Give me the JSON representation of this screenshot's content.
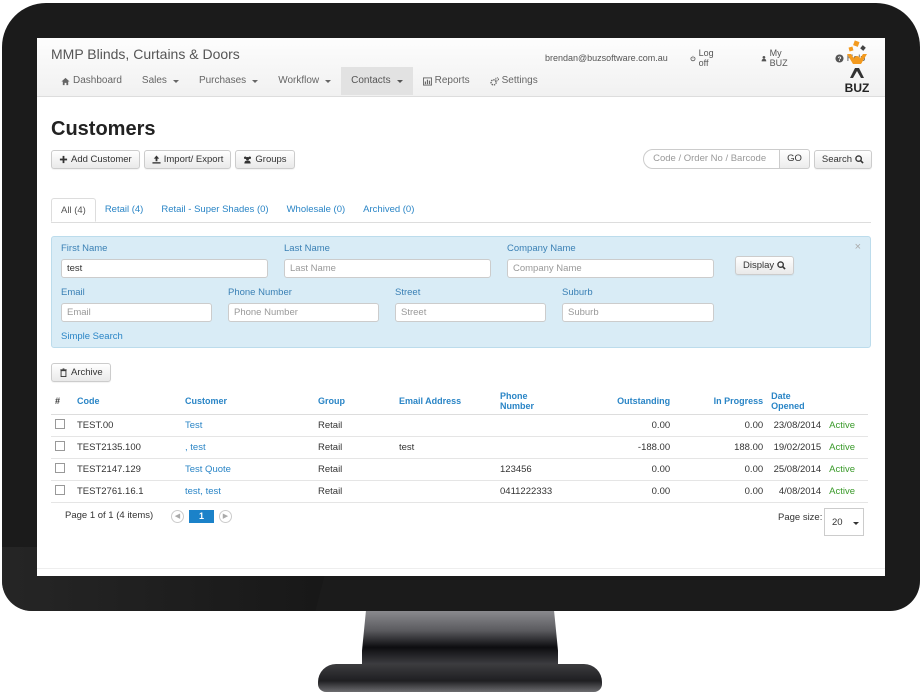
{
  "app": {
    "title": "MMP Blinds, Curtains & Doors",
    "user_email": "brendan@buzsoftware.com.au",
    "logoff_label": "Log off",
    "mybuz_label": "My BUZ",
    "help_label": "Help",
    "logo_text": "BUZ",
    "logo_colors": {
      "orange": "#f39a1e",
      "dark": "#333333"
    }
  },
  "nav": {
    "items": [
      {
        "label": "Dashboard",
        "icon": "home-icon",
        "dropdown": false,
        "active": false
      },
      {
        "label": "Sales",
        "dropdown": true,
        "active": false
      },
      {
        "label": "Purchases",
        "dropdown": true,
        "active": false
      },
      {
        "label": "Workflow",
        "dropdown": true,
        "active": false
      },
      {
        "label": "Contacts",
        "dropdown": true,
        "active": true
      },
      {
        "label": "Reports",
        "icon": "chart-icon",
        "dropdown": false,
        "active": false
      },
      {
        "label": "Settings",
        "icon": "gears-icon",
        "dropdown": false,
        "active": false
      }
    ]
  },
  "page": {
    "title": "Customers",
    "toolbar": {
      "add_label": "Add Customer",
      "import_label": "Import/ Export",
      "groups_label": "Groups"
    },
    "quick_search": {
      "placeholder": "Code / Order No / Barcode",
      "go_label": "GO",
      "search_label": "Search"
    }
  },
  "tabs": [
    {
      "label": "All (4)",
      "active": true
    },
    {
      "label": "Retail (4)",
      "active": false
    },
    {
      "label": "Retail - Super Shades (0)",
      "active": false
    },
    {
      "label": "Wholesale (0)",
      "active": false
    },
    {
      "label": "Archived (0)",
      "active": false
    }
  ],
  "filter": {
    "first_name": {
      "label": "First Name",
      "value": "test",
      "placeholder": "First Name"
    },
    "last_name": {
      "label": "Last Name",
      "value": "",
      "placeholder": "Last Name"
    },
    "company_name": {
      "label": "Company Name",
      "value": "",
      "placeholder": "Company Name"
    },
    "email": {
      "label": "Email",
      "value": "",
      "placeholder": "Email"
    },
    "phone": {
      "label": "Phone Number",
      "value": "",
      "placeholder": "Phone Number"
    },
    "street": {
      "label": "Street",
      "value": "",
      "placeholder": "Street"
    },
    "suburb": {
      "label": "Suburb",
      "value": "",
      "placeholder": "Suburb"
    },
    "display_label": "Display",
    "simple_search_label": "Simple Search",
    "close_glyph": "×"
  },
  "archive_label": "Archive",
  "table": {
    "columns": [
      "#",
      "Code",
      "Customer",
      "Group",
      "Email Address",
      "Phone Number",
      "Outstanding",
      "In Progress",
      "Date Opened",
      ""
    ],
    "rows": [
      {
        "code": "TEST.00",
        "customer": "Test",
        "group": "Retail",
        "email": "",
        "phone": "",
        "outstanding": "0.00",
        "in_progress": "0.00",
        "date_opened": "23/08/2014",
        "status": "Active"
      },
      {
        "code": "TEST2135.100",
        "customer": ", test",
        "group": "Retail",
        "email": "test",
        "phone": "",
        "outstanding": "-188.00",
        "in_progress": "188.00",
        "date_opened": "19/02/2015",
        "status": "Active"
      },
      {
        "code": "TEST2147.129",
        "customer": "Test Quote",
        "group": "Retail",
        "email": "",
        "phone": "123456",
        "outstanding": "0.00",
        "in_progress": "0.00",
        "date_opened": "25/08/2014",
        "status": "Active"
      },
      {
        "code": "TEST2761.16.1",
        "customer": "test, test",
        "group": "Retail",
        "email": "",
        "phone": "0411222333",
        "outstanding": "0.00",
        "in_progress": "0.00",
        "date_opened": "4/08/2014",
        "status": "Active"
      }
    ]
  },
  "pager": {
    "info": "Page 1 of 1 (4 items)",
    "current_page": "1",
    "page_size_label": "Page size:",
    "page_size": "20"
  }
}
